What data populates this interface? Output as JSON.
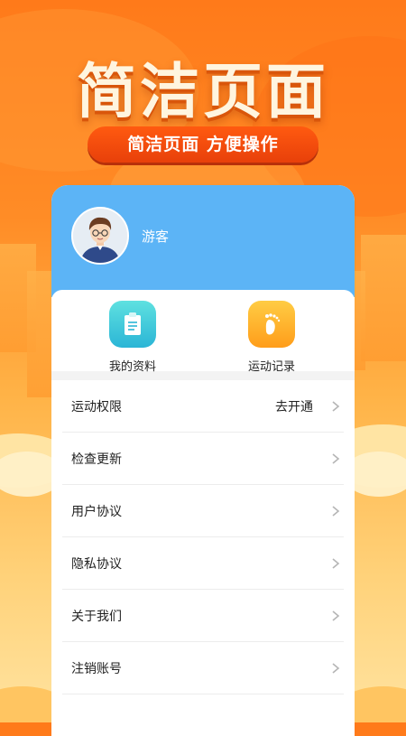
{
  "banner": {
    "title": "简洁页面",
    "subtitle": "简洁页面  方便操作"
  },
  "profile": {
    "username": "游客",
    "avatar_icon": "user-avatar"
  },
  "shortcuts": [
    {
      "label": "我的资料",
      "icon": "clipboard-icon",
      "color": "#2bb5d6"
    },
    {
      "label": "运动记录",
      "icon": "footprint-icon",
      "color": "#ff9d1a"
    }
  ],
  "menu": [
    {
      "label": "运动权限",
      "action": "去开通"
    },
    {
      "label": "检查更新",
      "action": ""
    },
    {
      "label": "用户协议",
      "action": ""
    },
    {
      "label": "隐私协议",
      "action": ""
    },
    {
      "label": "关于我们",
      "action": ""
    },
    {
      "label": "注销账号",
      "action": ""
    }
  ],
  "colors": {
    "header_blue": "#5cb4f6",
    "accent_orange": "#ff7a1a",
    "pill_red": "#e8400a"
  }
}
